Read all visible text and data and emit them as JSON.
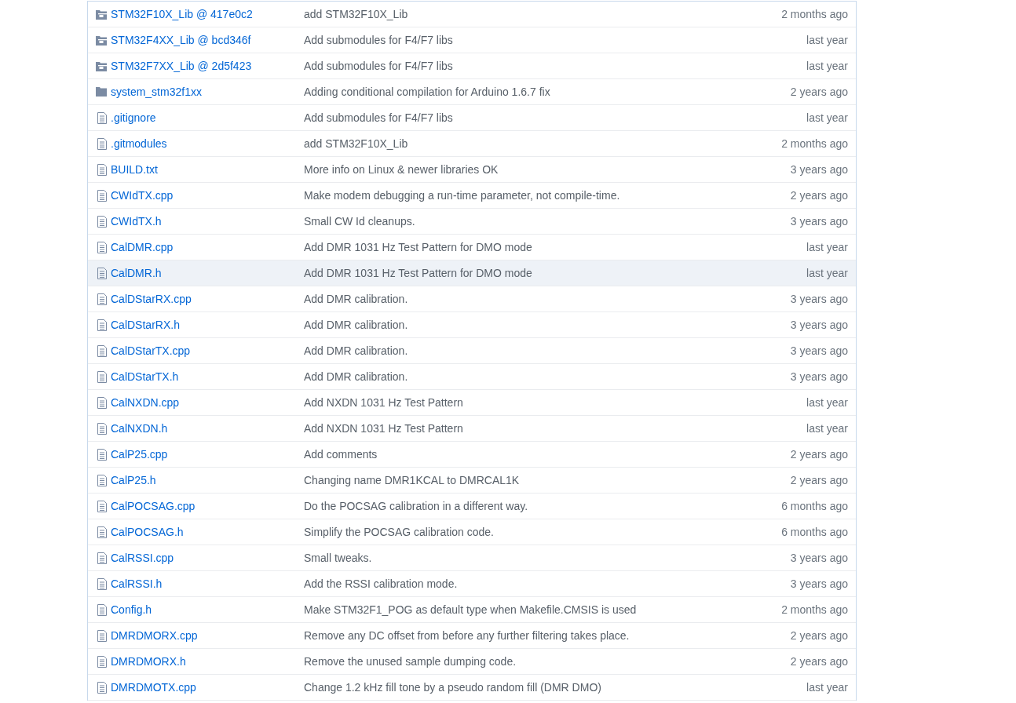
{
  "files": [
    {
      "kind": "submodule",
      "name": "STM32F10X_Lib @ 417e0c2",
      "message": "add STM32F10X_Lib",
      "age": "2 months ago",
      "selected": false
    },
    {
      "kind": "submodule",
      "name": "STM32F4XX_Lib @ bcd346f",
      "message": "Add submodules for F4/F7 libs",
      "age": "last year",
      "selected": false
    },
    {
      "kind": "submodule",
      "name": "STM32F7XX_Lib @ 2d5f423",
      "message": "Add submodules for F4/F7 libs",
      "age": "last year",
      "selected": false
    },
    {
      "kind": "directory",
      "name": "system_stm32f1xx",
      "message": "Adding conditional compilation for Arduino 1.6.7 fix",
      "age": "2 years ago",
      "selected": false
    },
    {
      "kind": "file",
      "name": ".gitignore",
      "message": "Add submodules for F4/F7 libs",
      "age": "last year",
      "selected": false
    },
    {
      "kind": "file",
      "name": ".gitmodules",
      "message": "add STM32F10X_Lib",
      "age": "2 months ago",
      "selected": false
    },
    {
      "kind": "file",
      "name": "BUILD.txt",
      "message": "More info on Linux & newer libraries OK",
      "age": "3 years ago",
      "selected": false
    },
    {
      "kind": "file",
      "name": "CWIdTX.cpp",
      "message": "Make modem debugging a run-time parameter, not compile-time.",
      "age": "2 years ago",
      "selected": false
    },
    {
      "kind": "file",
      "name": "CWIdTX.h",
      "message": "Small CW Id cleanups.",
      "age": "3 years ago",
      "selected": false
    },
    {
      "kind": "file",
      "name": "CalDMR.cpp",
      "message": "Add DMR 1031 Hz Test Pattern for DMO mode",
      "age": "last year",
      "selected": false
    },
    {
      "kind": "file",
      "name": "CalDMR.h",
      "message": "Add DMR 1031 Hz Test Pattern for DMO mode",
      "age": "last year",
      "selected": true
    },
    {
      "kind": "file",
      "name": "CalDStarRX.cpp",
      "message": "Add DMR calibration.",
      "age": "3 years ago",
      "selected": false
    },
    {
      "kind": "file",
      "name": "CalDStarRX.h",
      "message": "Add DMR calibration.",
      "age": "3 years ago",
      "selected": false
    },
    {
      "kind": "file",
      "name": "CalDStarTX.cpp",
      "message": "Add DMR calibration.",
      "age": "3 years ago",
      "selected": false
    },
    {
      "kind": "file",
      "name": "CalDStarTX.h",
      "message": "Add DMR calibration.",
      "age": "3 years ago",
      "selected": false
    },
    {
      "kind": "file",
      "name": "CalNXDN.cpp",
      "message": "Add NXDN 1031 Hz Test Pattern",
      "age": "last year",
      "selected": false
    },
    {
      "kind": "file",
      "name": "CalNXDN.h",
      "message": "Add NXDN 1031 Hz Test Pattern",
      "age": "last year",
      "selected": false
    },
    {
      "kind": "file",
      "name": "CalP25.cpp",
      "message": "Add comments",
      "age": "2 years ago",
      "selected": false
    },
    {
      "kind": "file",
      "name": "CalP25.h",
      "message": "Changing name DMR1KCAL to DMRCAL1K",
      "age": "2 years ago",
      "selected": false
    },
    {
      "kind": "file",
      "name": "CalPOCSAG.cpp",
      "message": "Do the POCSAG calibration in a different way.",
      "age": "6 months ago",
      "selected": false
    },
    {
      "kind": "file",
      "name": "CalPOCSAG.h",
      "message": "Simplify the POCSAG calibration code.",
      "age": "6 months ago",
      "selected": false
    },
    {
      "kind": "file",
      "name": "CalRSSI.cpp",
      "message": "Small tweaks.",
      "age": "3 years ago",
      "selected": false
    },
    {
      "kind": "file",
      "name": "CalRSSI.h",
      "message": "Add the RSSI calibration mode.",
      "age": "3 years ago",
      "selected": false
    },
    {
      "kind": "file",
      "name": "Config.h",
      "message": "Make STM32F1_POG as default type when Makefile.CMSIS is used",
      "age": "2 months ago",
      "selected": false
    },
    {
      "kind": "file",
      "name": "DMRDMORX.cpp",
      "message": "Remove any DC offset from before any further filtering takes place.",
      "age": "2 years ago",
      "selected": false
    },
    {
      "kind": "file",
      "name": "DMRDMORX.h",
      "message": "Remove the unused sample dumping code.",
      "age": "2 years ago",
      "selected": false
    },
    {
      "kind": "file",
      "name": "DMRDMOTX.cpp",
      "message": "Change 1.2 kHz fill tone by a pseudo random fill (DMR DMO)",
      "age": "last year",
      "selected": false
    }
  ]
}
